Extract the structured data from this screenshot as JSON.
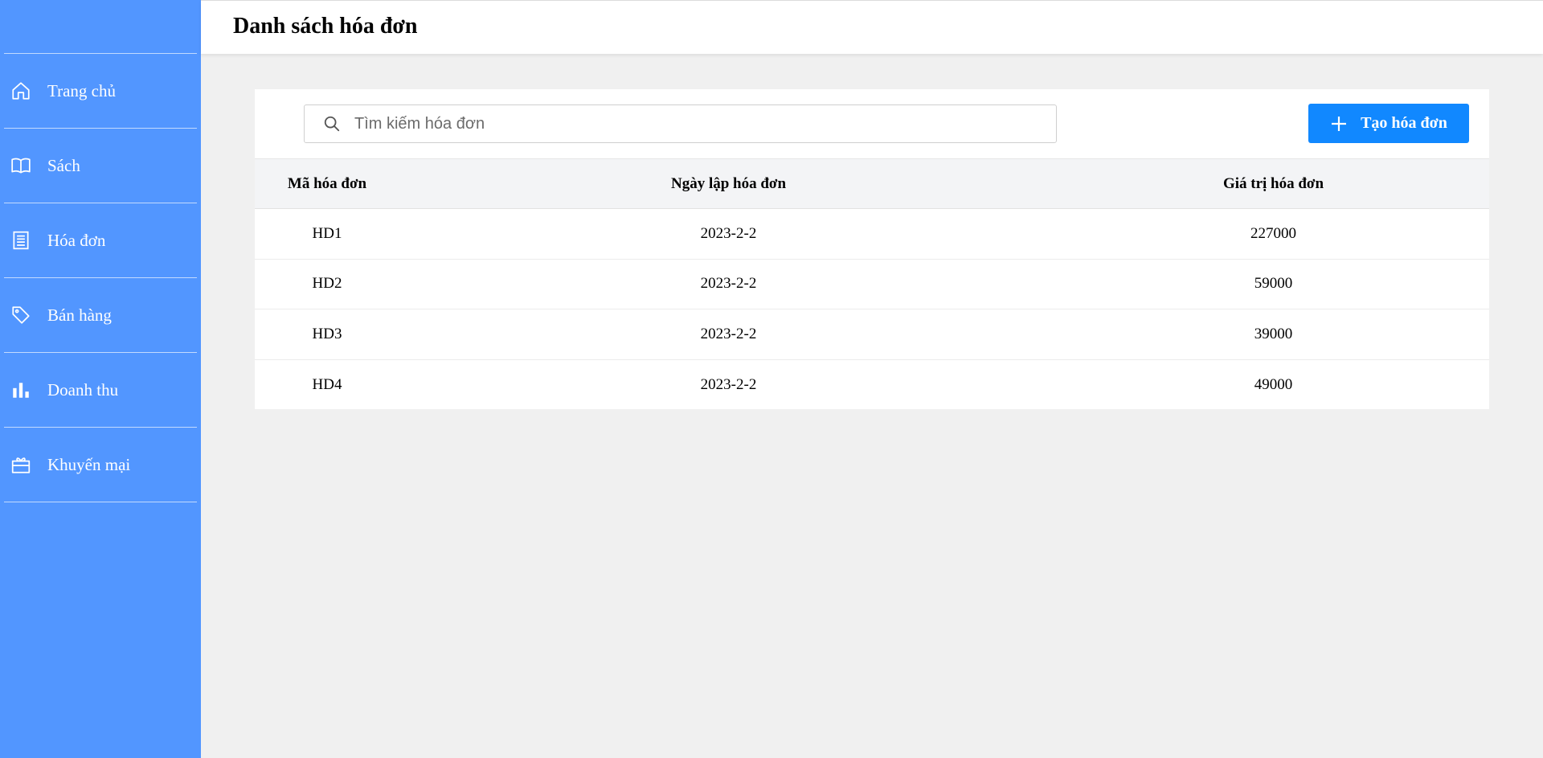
{
  "page": {
    "title": "Danh sách hóa đơn"
  },
  "sidebar": {
    "items": [
      {
        "label": "Trang chủ",
        "icon": "home-icon"
      },
      {
        "label": "Sách",
        "icon": "book-icon"
      },
      {
        "label": "Hóa đơn",
        "icon": "receipt-icon"
      },
      {
        "label": "Bán hàng",
        "icon": "tag-icon"
      },
      {
        "label": "Doanh thu",
        "icon": "bar-chart-icon"
      },
      {
        "label": "Khuyến mại",
        "icon": "gift-icon"
      }
    ],
    "background": "#5296ff"
  },
  "search": {
    "placeholder": "Tìm kiếm hóa đơn",
    "value": ""
  },
  "toolbar": {
    "create_label": "Tạo hóa đơn",
    "accent": "#1188ff"
  },
  "table": {
    "columns": [
      "Mã hóa đơn",
      "Ngày lập hóa đơn",
      "Giá trị hóa đơn"
    ],
    "rows": [
      {
        "id": "HD1",
        "date": "2023-2-2",
        "value": "227000"
      },
      {
        "id": "HD2",
        "date": "2023-2-2",
        "value": "59000"
      },
      {
        "id": "HD3",
        "date": "2023-2-2",
        "value": "39000"
      },
      {
        "id": "HD4",
        "date": "2023-2-2",
        "value": "49000"
      }
    ]
  }
}
